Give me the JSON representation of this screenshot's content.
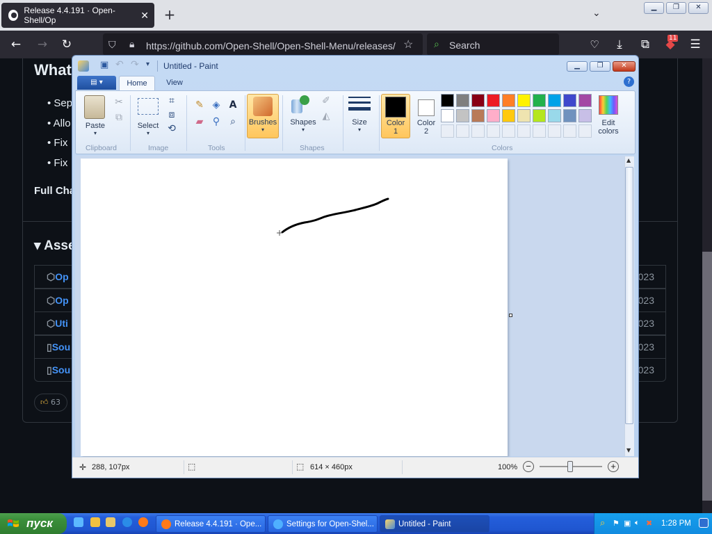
{
  "browser": {
    "tab_title": "Release 4.4.191 · Open-Shell/Op",
    "url": "https://github.com/Open-Shell/Open-Shell-Menu/releases/",
    "search_placeholder": "Search",
    "extension_badge": "11"
  },
  "github": {
    "heading": "What",
    "bullets": [
      "Sep",
      "Allo",
      "Fix",
      "Fix"
    ],
    "full_changelog": "Full Cha",
    "assets_heading": "Asse",
    "assets": [
      {
        "name": "Op",
        "date": "023"
      },
      {
        "name": "Op",
        "date": "023"
      },
      {
        "name": "Uti",
        "date": "023"
      },
      {
        "name": "Sou",
        "date": "023"
      },
      {
        "name": "Sou",
        "date": "023"
      }
    ],
    "reaction_count": "63"
  },
  "paint": {
    "title": "Untitled - Paint",
    "tabs": [
      "Home",
      "View"
    ],
    "groups": {
      "clipboard": "Clipboard",
      "image": "Image",
      "tools": "Tools",
      "shapes": "Shapes",
      "colors": "Colors"
    },
    "buttons": {
      "paste": "Paste",
      "select": "Select",
      "brushes": "Brushes",
      "shapes": "Shapes",
      "size": "Size",
      "color1_a": "Color",
      "color1_b": "1",
      "color2_a": "Color",
      "color2_b": "2",
      "edit_colors_a": "Edit",
      "edit_colors_b": "colors"
    },
    "palette_row1": [
      "#000000",
      "#7f7f7f",
      "#880015",
      "#ed1c24",
      "#ff7f27",
      "#fff200",
      "#22b14c",
      "#00a2e8",
      "#3f48cc",
      "#a349a4"
    ],
    "palette_row2": [
      "#ffffff",
      "#c3c3c3",
      "#b97a57",
      "#ffaec9",
      "#ffc90e",
      "#efe4b0",
      "#b5e61d",
      "#99d9ea",
      "#7092be",
      "#c8bfe7"
    ],
    "color1": "#000000",
    "color2": "#ffffff",
    "status": {
      "cursor_pos": "288, 107px",
      "canvas_size": "614 × 460px",
      "zoom": "100%"
    }
  },
  "taskbar": {
    "start_label": "пуск",
    "buttons": [
      {
        "label": "Release 4.4.191 · Ope..."
      },
      {
        "label": "Settings for Open-Shel..."
      },
      {
        "label": "Untitled - Paint"
      }
    ],
    "clock": "1:28 PM"
  },
  "colors": {
    "xp_blue": "#245edb",
    "start_green": "#3b8f3b",
    "github_bg": "#0d1117",
    "github_link": "#4493f8"
  }
}
